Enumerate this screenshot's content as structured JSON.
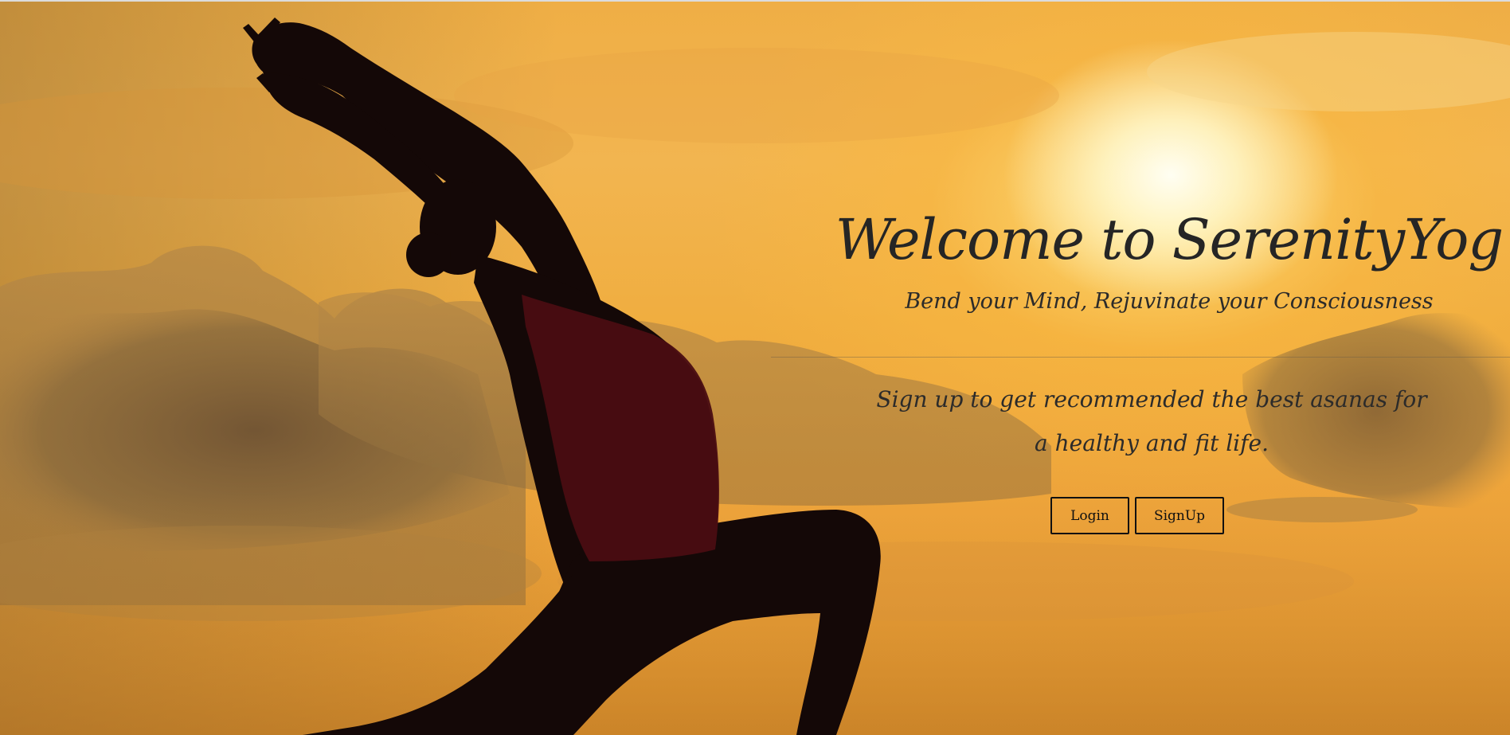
{
  "hero": {
    "title": "Welcome to SerenityYog",
    "subtitle": "Bend your Mind, Rejuvinate your Consciousness",
    "cta_text": "Sign up to get recommended the best asanas for a healthy and fit life."
  },
  "actions": {
    "login_label": "Login",
    "signup_label": "SignUp"
  },
  "colors": {
    "sky": "#f0ad3f",
    "sun_glow": "#fff8d9",
    "clouds": "#8a6a3c",
    "silhouette": "#140807",
    "tank_top": "#4a0d12",
    "text": "#252525"
  }
}
